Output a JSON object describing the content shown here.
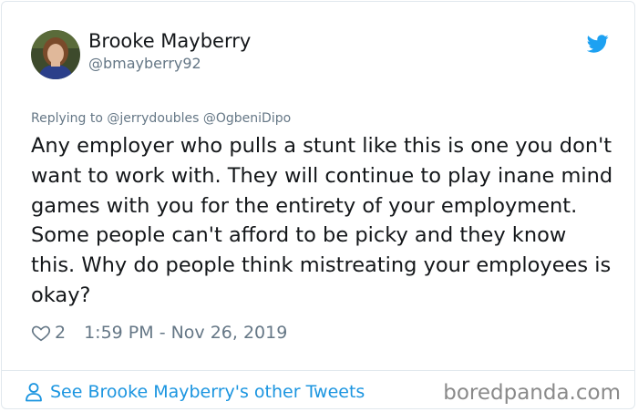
{
  "author": {
    "display_name": "Brooke Mayberry",
    "handle": "@bmayberry92"
  },
  "icons": {
    "brand": "twitter-bird-icon",
    "like": "heart-outline-icon",
    "profile": "person-outline-icon"
  },
  "reply": {
    "text": "Replying to @jerrydoubles @OgbeniDipo"
  },
  "tweet": {
    "text": "Any employer who pulls a stunt like this is one you don't want to work with. They will continue to play inane mind games with you for the entirety of your employment. Some people can't afford to be picky and they know this. Why do people think mistreating your employees is okay?",
    "like_count": "2",
    "timestamp": "1:59 PM - Nov 26, 2019"
  },
  "footer": {
    "link_text": "See Brooke Mayberry's other Tweets"
  },
  "watermark": "boredpanda.com",
  "colors": {
    "accent": "#1b95e0",
    "twitter_blue": "#1da1f2",
    "secondary_text": "#657786",
    "border": "#e1e8ed"
  }
}
